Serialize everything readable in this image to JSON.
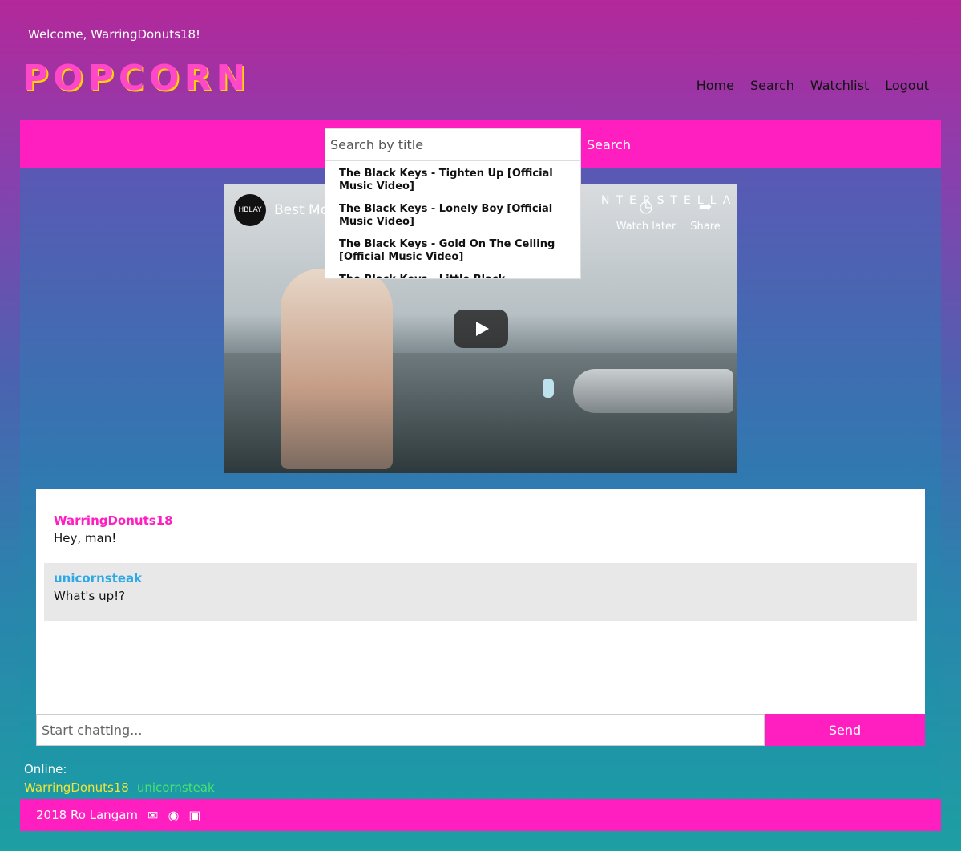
{
  "header": {
    "welcome": "Welcome, WarringDonuts18!",
    "logo": "POPCORN",
    "nav": [
      "Home",
      "Search",
      "Watchlist",
      "Logout"
    ]
  },
  "search": {
    "placeholder": "Search by title",
    "button_label": "Search",
    "results": [
      "The Black Keys - Tighten Up [Official Music Video]",
      "The Black Keys - Lonely Boy [Official Music Video]",
      "The Black Keys - Gold On The Ceiling [Official Music Video]",
      "The Black Keys - Little Black Submarines"
    ]
  },
  "video": {
    "title": "Best Mo",
    "overlay_text": "NTERSTELLAR",
    "channel_avatar": "HBLAY",
    "watch_later": "Watch later",
    "share": "Share"
  },
  "chat": {
    "messages": [
      {
        "author": "WarringDonuts18",
        "text": "Hey, man!",
        "author_color": "#ff1fc0"
      },
      {
        "author": "unicornsteak",
        "text": "What's up!?",
        "author_color": "#2ea8e6"
      }
    ],
    "input_placeholder": "Start chatting...",
    "send_label": "Send"
  },
  "online": {
    "label": "Online:",
    "users": [
      {
        "name": "WarringDonuts18",
        "color": "#f1e635"
      },
      {
        "name": "unicornsteak",
        "color": "#4be36c"
      }
    ]
  },
  "footer": {
    "copyright": "2018 Ro Langam",
    "icons": [
      "envelope-icon",
      "github-icon",
      "linkedin-icon"
    ]
  }
}
